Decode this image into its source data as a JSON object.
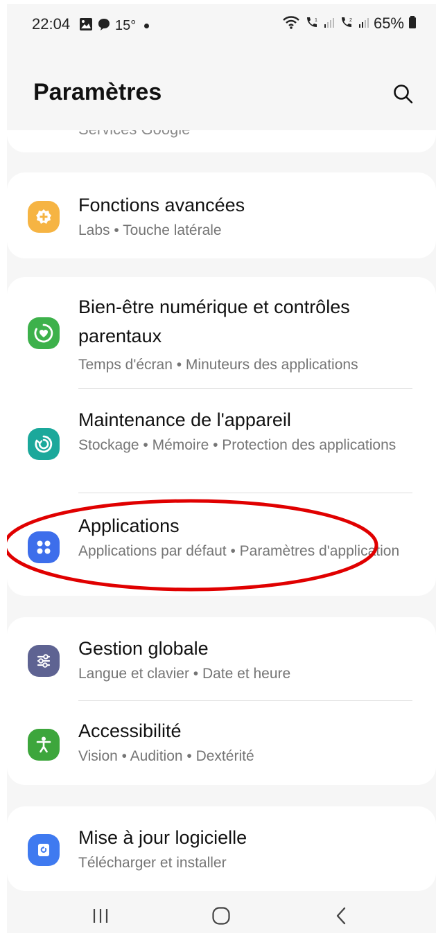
{
  "status_bar": {
    "time": "22:04",
    "temperature": "15°",
    "battery": "65%"
  },
  "header": {
    "title": "Paramètres"
  },
  "partial_item": {
    "text": "Services Google"
  },
  "items": [
    {
      "title": "Fonctions avancées",
      "subtitle": "Labs • Touche latérale",
      "icon": "plus-gear-icon",
      "icon_color": "#F6B443"
    },
    {
      "title": "Bien-être numérique et contrôles parentaux",
      "subtitle": "Temps d'écran • Minuteurs des applications",
      "icon": "heart-ring-icon",
      "icon_color": "#3DB14B"
    },
    {
      "title": "Maintenance de l'appareil",
      "subtitle": "Stockage • Mémoire • Protection des applications",
      "icon": "refresh-care-icon",
      "icon_color": "#1BA89B"
    },
    {
      "title": "Applications",
      "subtitle": "Applications par défaut • Paramètres d'application",
      "icon": "apps-grid-icon",
      "icon_color": "#3D6EEB"
    },
    {
      "title": "Gestion globale",
      "subtitle": "Langue et clavier • Date et heure",
      "icon": "sliders-icon",
      "icon_color": "#5E6392"
    },
    {
      "title": "Accessibilité",
      "subtitle": "Vision • Audition • Dextérité",
      "icon": "accessibility-person-icon",
      "icon_color": "#3DA63C"
    },
    {
      "title": "Mise à jour logicielle",
      "subtitle": "Télécharger et installer",
      "icon": "update-icon",
      "icon_color": "#3F7AF0"
    }
  ],
  "annotation": {
    "color": "#E00000"
  },
  "nav": {
    "buttons": [
      "recent-apps-icon",
      "home-icon",
      "back-icon"
    ]
  }
}
